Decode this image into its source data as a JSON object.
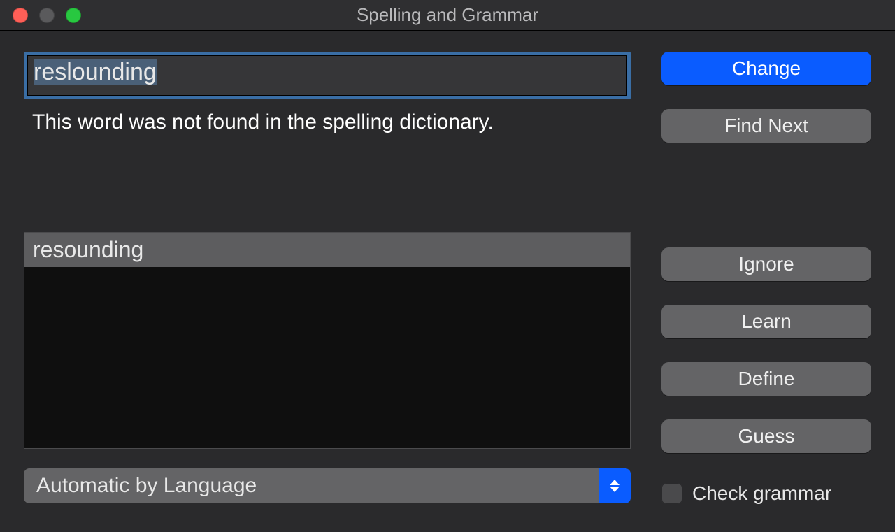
{
  "window": {
    "title": "Spelling and Grammar"
  },
  "misspelled": {
    "value": "reslounding",
    "selected": true
  },
  "status": "This word was not found in the spelling dictionary.",
  "suggestions": [
    "resounding"
  ],
  "language_select": {
    "value": "Automatic by Language"
  },
  "buttons": {
    "change": "Change",
    "find_next": "Find Next",
    "ignore": "Ignore",
    "learn": "Learn",
    "define": "Define",
    "guess": "Guess"
  },
  "check_grammar": {
    "label": "Check grammar",
    "checked": false
  }
}
